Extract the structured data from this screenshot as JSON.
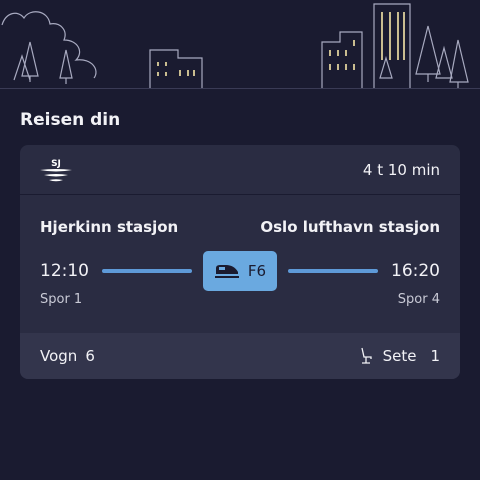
{
  "section_title": "Reisen din",
  "ticket": {
    "operator_logo": "SJ",
    "duration": "4 t 10 min",
    "from_station": "Hjerkinn stasjon",
    "to_station": "Oslo lufthavn stasjon",
    "departure_time": "12:10",
    "arrival_time": "16:20",
    "from_track": "Spor 1",
    "to_track": "Spor 4",
    "train_line": "F6",
    "train_icon": "train-icon",
    "wagon_label": "Vogn",
    "wagon_number": "6",
    "seat_icon": "seat-icon",
    "seat_label": "Sete",
    "seat_number": "1"
  },
  "colors": {
    "background": "#1a1b30",
    "card": "#2a2c42",
    "card_footer": "#33354c",
    "accent": "#6aa9e0",
    "window_light": "#f5e6a8"
  }
}
